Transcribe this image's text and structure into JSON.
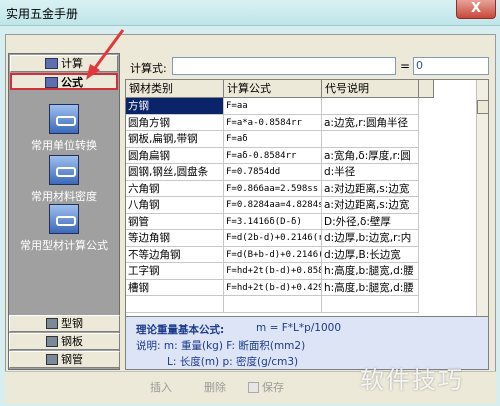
{
  "window": {
    "title": "实用五金手册",
    "close_glyph": "X"
  },
  "left_nav": {
    "calc_label": "计算",
    "formula_label": "公式",
    "items": [
      {
        "label": "常用单位转换"
      },
      {
        "label": "常用材料密度"
      },
      {
        "label": "常用型材计算公式"
      }
    ],
    "bottom_tabs": [
      {
        "label": "型钢"
      },
      {
        "label": "钢板"
      },
      {
        "label": "钢管"
      }
    ]
  },
  "formula_bar": {
    "label": "计算式:",
    "value": "",
    "equals": "=",
    "result": "0"
  },
  "table": {
    "columns": [
      "钢材类别",
      "计算公式",
      "代号说明"
    ],
    "rows": [
      {
        "category": "方钢",
        "formula": "F=aa",
        "notes": "",
        "selected": true
      },
      {
        "category": "圆角方钢",
        "formula": "F=a*a-0.8584rr",
        "notes": "a:边宽,r:圆角半径"
      },
      {
        "category": "钢板,扁钢,带钢",
        "formula": "F=aδ",
        "notes": ""
      },
      {
        "category": "圆角扁钢",
        "formula": "F=aδ-0.8584rr",
        "notes": "a:宽角,δ:厚度,r:圆"
      },
      {
        "category": "圆钢,钢丝,圆盘条",
        "formula": "F=0.7854dd",
        "notes": "d:半径"
      },
      {
        "category": "六角钢",
        "formula": "F=0.866aa=2.598ss",
        "notes": "a:对边距离,s:边宽"
      },
      {
        "category": "八角钢",
        "formula": "F=0.8284aa=4.8284s",
        "notes": "a:对边距离,s:边宽"
      },
      {
        "category": "钢管",
        "formula": "F=3.1416δ(D-δ)",
        "notes": "D:外径,δ:壁厚"
      },
      {
        "category": "等边角钢",
        "formula": "F=d(2b-d)+0.2146(r",
        "notes": "d:边厚,b:边宽,r:内"
      },
      {
        "category": "不等边角钢",
        "formula": "F=d(B+b-d)+0.2146(",
        "notes": "d:边厚,B:长边宽"
      },
      {
        "category": "工字钢",
        "formula": "F=hd+2t(b-d)+0.858",
        "notes": "h:高度,b:腿宽,d:腰"
      },
      {
        "category": "槽钢",
        "formula": "F=hd+2t(b-d)+0.429",
        "notes": "h:高度,b:腿宽,d:腰"
      },
      {
        "category": "",
        "formula": "",
        "notes": ""
      }
    ]
  },
  "info": {
    "line1_label": "理论重量基本公式:",
    "line1_formula": "m = F*L*p/1000",
    "line2": "说明: m: 重量(kg)  F: 断面积(mm2)",
    "line3": "L: 长度(m)   p: 密度(g/cm3)"
  },
  "toolbar": {
    "insert": "插入",
    "delete": "删除",
    "save": "保存"
  },
  "watermark": "软件技巧",
  "colors": {
    "selection": "#0a246a",
    "highlight_border": "#d0313a",
    "arrow": "#e2383b"
  }
}
